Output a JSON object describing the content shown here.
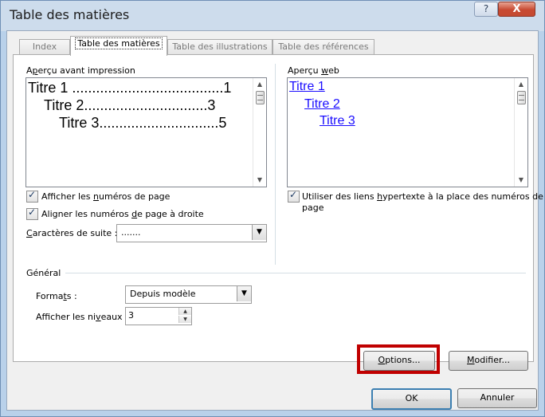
{
  "window": {
    "title": "Table des matières",
    "help_glyph": "?",
    "close_glyph": "X"
  },
  "tabs": [
    "Index",
    "Table des matières",
    "Table des illustrations",
    "Table des références"
  ],
  "print_preview": {
    "label_pre": "A",
    "label_u": "p",
    "label_post": "erçu avant impression",
    "entries": [
      {
        "text": "Titre 1 ",
        "dots": "......................................",
        "page": "1"
      },
      {
        "text": "Titre 2",
        "dots": "...............................",
        "page": "3"
      },
      {
        "text": "Titre 3",
        "dots": "..............................",
        "page": "5"
      }
    ]
  },
  "web_preview": {
    "label_pre": "Aperçu ",
    "label_u": "w",
    "label_post": "eb",
    "links": [
      "Titre 1",
      "Titre 2",
      "Titre 3"
    ]
  },
  "options": {
    "show_page_numbers": {
      "pre": "Afficher les ",
      "u": "n",
      "post": "uméros de page",
      "checked": true
    },
    "align_right": {
      "pre": "Aligner les numéros ",
      "u": "d",
      "post": "e page à droite",
      "checked": true
    },
    "tab_leader_label": {
      "pre": "",
      "u": "C",
      "post": "aractères de suite :"
    },
    "tab_leader_value": ".......",
    "hyperlinks": {
      "pre": "Utiliser des liens ",
      "u": "h",
      "post": "ypertexte à la place des numéros de",
      "line2": "page",
      "checked": true
    }
  },
  "general": {
    "heading": "Général",
    "formats_label": {
      "pre": "Forma",
      "u": "t",
      "post": "s :"
    },
    "formats_value": "Depuis modèle",
    "levels_label": {
      "pre": "Afficher les ni",
      "u": "v",
      "post": "eaux :"
    },
    "levels_value": "3"
  },
  "buttons": {
    "options": {
      "pre": "",
      "u": "O",
      "post": "ptions..."
    },
    "modify": {
      "pre": "",
      "u": "M",
      "post": "odifier..."
    },
    "ok": "OK",
    "cancel": "Annuler"
  },
  "colors": {
    "link": "#1a0dff",
    "highlight": "#c00000",
    "title_bar": "#cddcec"
  }
}
